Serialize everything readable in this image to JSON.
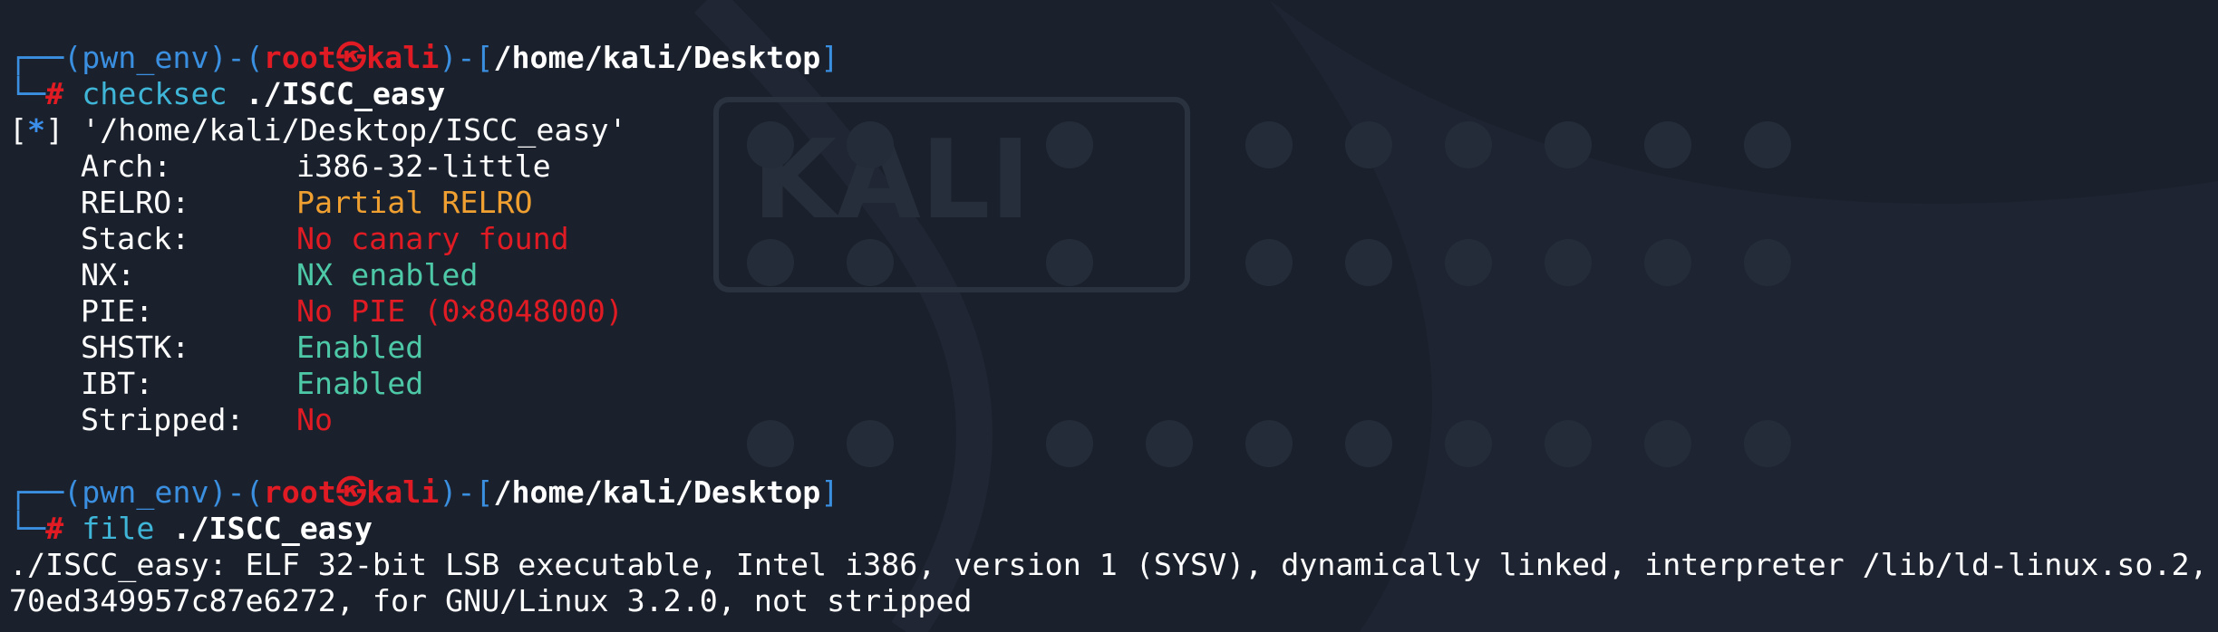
{
  "prompt1": {
    "corner": "┌──(",
    "env": "pwn_env",
    "sep1": ")-(",
    "user": "root",
    "at": "㉿",
    "host": "kali",
    "sep2": ")-[",
    "path": "/home/kali/Desktop",
    "close": "]"
  },
  "cmd1": {
    "corner": "└─",
    "hash": "#",
    "command": "checksec",
    "arg": "./ISCC_easy"
  },
  "checksec": {
    "header_open": "[",
    "header_star": "*",
    "header_close": "]",
    "header_path": " '/home/kali/Desktop/ISCC_easy'",
    "rows": [
      {
        "label": "Arch:",
        "value": "i386-32-little",
        "color": "#ffffff"
      },
      {
        "label": "RELRO:",
        "value": "Partial RELRO",
        "color": "#f0a030"
      },
      {
        "label": "Stack:",
        "value": "No canary found",
        "color": "#e01b24"
      },
      {
        "label": "NX:",
        "value": "NX enabled",
        "color": "#4ec9a8"
      },
      {
        "label": "PIE:",
        "value": "No PIE (0×8048000)",
        "color": "#e01b24"
      },
      {
        "label": "SHSTK:",
        "value": "Enabled",
        "color": "#4ec9a8"
      },
      {
        "label": "IBT:",
        "value": "Enabled",
        "color": "#4ec9a8"
      },
      {
        "label": "Stripped:",
        "value": "No",
        "color": "#e01b24"
      }
    ]
  },
  "prompt2": {
    "corner": "┌──(",
    "env": "pwn_env",
    "sep1": ")-(",
    "user": "root",
    "at": "㉿",
    "host": "kali",
    "sep2": ")-[",
    "path": "/home/kali/Desktop",
    "close": "]"
  },
  "cmd2": {
    "corner": "└─",
    "hash": "#",
    "command": "file",
    "arg": "./ISCC_easy"
  },
  "file_output": {
    "line1": "./ISCC_easy: ELF 32-bit LSB executable, Intel i386, version 1 (SYSV), dynamically linked, interpreter /lib/ld-linux.so.2,",
    "line2": "70ed349957c87e6272, for GNU/Linux 3.2.0, not stripped"
  },
  "colors": {
    "background": "#1b212c",
    "prompt_blue": "#3a8fe0",
    "root_red": "#e01b24",
    "command_cyan": "#3fb6d8"
  }
}
